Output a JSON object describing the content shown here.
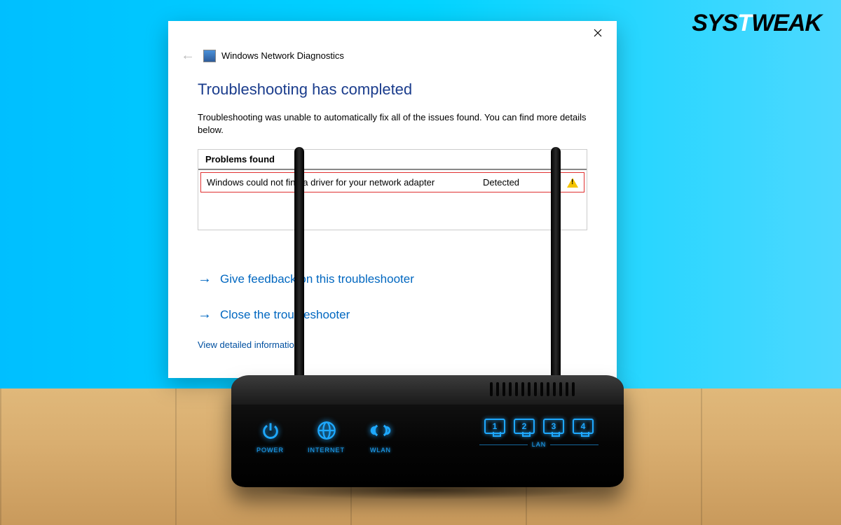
{
  "brand": {
    "first": "SYS",
    "mid": "T",
    "rest": "WEAK"
  },
  "dialog": {
    "title": "Windows Network Diagnostics",
    "heading": "Troubleshooting has completed",
    "description": "Troubleshooting was unable to automatically fix all of the issues found. You can find more details below.",
    "problems_header": "Problems found",
    "problem": {
      "text": "Windows could not find a driver for your network adapter",
      "status": "Detected"
    },
    "actions": {
      "feedback": "Give feedback on this troubleshooter",
      "close": "Close the troubleshooter"
    },
    "detail_link": "View detailed information"
  },
  "router": {
    "leds": [
      {
        "name": "power",
        "label": "POWER"
      },
      {
        "name": "internet",
        "label": "INTERNET"
      },
      {
        "name": "wlan",
        "label": "WLAN"
      }
    ],
    "lan": {
      "label": "LAN",
      "ports": [
        "1",
        "2",
        "3",
        "4"
      ]
    }
  }
}
